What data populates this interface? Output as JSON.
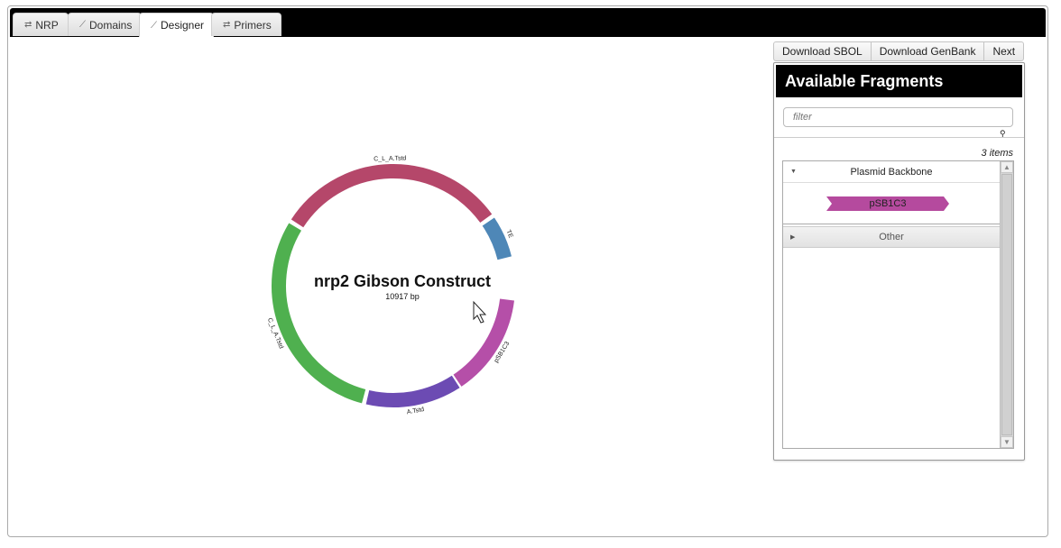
{
  "tabs": [
    {
      "label": "NRP",
      "icon": "arrows-icon"
    },
    {
      "label": "Domains",
      "icon": "wand-icon"
    },
    {
      "label": "Designer",
      "icon": "wand-icon"
    },
    {
      "label": "Primers",
      "icon": "arrows-icon"
    }
  ],
  "active_tab": "Designer",
  "toolbar": {
    "download_sbol": "Download SBOL",
    "download_genbank": "Download GenBank",
    "next": "Next"
  },
  "panel": {
    "title": "Available Fragments",
    "filter_placeholder": "filter",
    "count": "3 items",
    "groups": [
      {
        "label": "Plasmid Backbone",
        "expanded": true,
        "items": [
          {
            "label": "pSB1C3",
            "color": "#b54a9e"
          }
        ]
      },
      {
        "label": "Other",
        "expanded": false
      }
    ]
  },
  "construct": {
    "title": "nrp2 Gibson Construct",
    "length": "10917 bp",
    "segments": [
      {
        "label": "C_L_A.Tstd",
        "color": "#b5476a",
        "start_deg": 303,
        "end_deg": 54
      },
      {
        "label": "TE",
        "color": "#4e87b7",
        "start_deg": 56,
        "end_deg": 76
      },
      {
        "label": "pSB1C3",
        "color": "#b54fa8",
        "start_deg": 97,
        "end_deg": 146
      },
      {
        "label": "A.Tstd",
        "color": "#6c4bb3",
        "start_deg": 147,
        "end_deg": 193
      },
      {
        "label": "C_L_A.Tstd",
        "color": "#4fb04f",
        "start_deg": 195,
        "end_deg": 301
      }
    ]
  }
}
